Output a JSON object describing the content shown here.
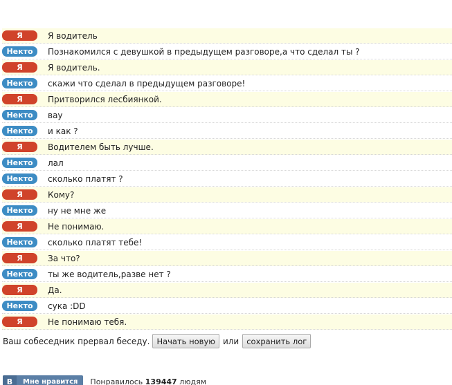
{
  "messages": [
    {
      "sender": "me",
      "label": "Я",
      "text": "Я водитель"
    },
    {
      "sender": "stranger",
      "label": "Некто",
      "text": "Познакомился с девушкой в предыдущем разговоре,а что сделал ты ?"
    },
    {
      "sender": "me",
      "label": "Я",
      "text": "Я водитель."
    },
    {
      "sender": "stranger",
      "label": "Некто",
      "text": "скажи что сделал в предыдущем разговоре!"
    },
    {
      "sender": "me",
      "label": "Я",
      "text": "Притворился лесбиянкой."
    },
    {
      "sender": "stranger",
      "label": "Некто",
      "text": "вау"
    },
    {
      "sender": "stranger",
      "label": "Некто",
      "text": "и как ?"
    },
    {
      "sender": "me",
      "label": "Я",
      "text": "Водителем быть лучше."
    },
    {
      "sender": "stranger",
      "label": "Некто",
      "text": "лал"
    },
    {
      "sender": "stranger",
      "label": "Некто",
      "text": "сколько платят ?"
    },
    {
      "sender": "me",
      "label": "Я",
      "text": "Кому?"
    },
    {
      "sender": "stranger",
      "label": "Некто",
      "text": "ну не мне же"
    },
    {
      "sender": "me",
      "label": "Я",
      "text": "Не понимаю."
    },
    {
      "sender": "stranger",
      "label": "Некто",
      "text": "сколько платят тебе!"
    },
    {
      "sender": "me",
      "label": "Я",
      "text": "За что?"
    },
    {
      "sender": "stranger",
      "label": "Некто",
      "text": "ты же водитель,разве нет ?"
    },
    {
      "sender": "me",
      "label": "Я",
      "text": "Да."
    },
    {
      "sender": "stranger",
      "label": "Некто",
      "text": "сука :DD"
    },
    {
      "sender": "me",
      "label": "Я",
      "text": "Не понимаю тебя."
    }
  ],
  "status": {
    "text": "Ваш собеседник прервал беседу.",
    "new_chat_label": "Начать новую",
    "or_text": "или",
    "save_log_label": "сохранить лог"
  },
  "vk": {
    "logo": "B",
    "like_label": "Мне нравится",
    "count_prefix": "Понравилось",
    "count": "139447",
    "count_suffix": "людям"
  },
  "colors": {
    "me_badge": "#d0432a",
    "stranger_badge": "#3d8cc4",
    "me_row_bg": "#fdfde3",
    "vk_blue": "#5b7fa6"
  }
}
